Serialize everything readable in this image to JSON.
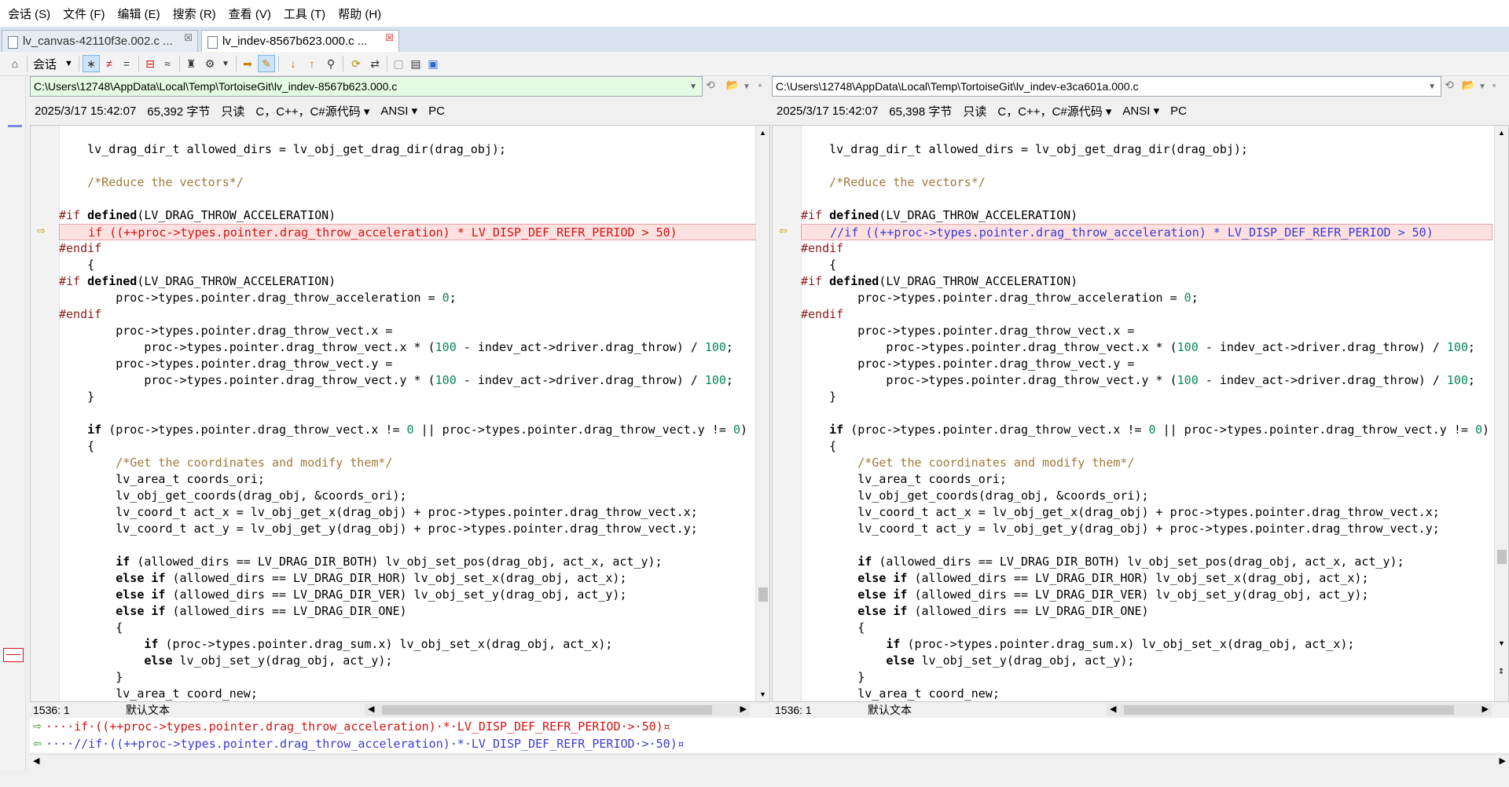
{
  "menu": [
    "会话 (S)",
    "文件 (F)",
    "编辑 (E)",
    "搜索 (R)",
    "查看 (V)",
    "工具 (T)",
    "帮助 (H)"
  ],
  "tabs": [
    {
      "label": "lv_canvas-42110f3e.002.c ...",
      "close": "☒"
    },
    {
      "label": "lv_indev-8567b623.000.c ...",
      "close": "☒"
    }
  ],
  "toolbar": {
    "session_combo": "会话"
  },
  "left": {
    "path": "C:\\Users\\12748\\AppData\\Local\\Temp\\TortoiseGit\\lv_indev-8567b623.000.c",
    "info": [
      "2025/3/17 15:42:07",
      "65,392 字节",
      "只读",
      "C，C++，C#源代码 ▾",
      "ANSI ▾",
      "PC"
    ],
    "status_pos": "1536: 1",
    "status_text": "默认文本"
  },
  "right": {
    "path": "C:\\Users\\12748\\AppData\\Local\\Temp\\TortoiseGit\\lv_indev-e3ca601a.000.c",
    "info": [
      "2025/3/17 15:42:07",
      "65,398 字节",
      "只读",
      "C，C++，C#源代码 ▾",
      "ANSI ▾",
      "PC"
    ],
    "status_pos": "1536: 1",
    "status_text": "默认文本"
  },
  "code": {
    "l1": "    lv_drag_dir_t allowed_dirs = lv_obj_get_drag_dir(drag_obj);",
    "l2": "    /*Reduce the vectors*/",
    "l3a": "#if ",
    "l3b": "defined",
    "l3c": "(LV_DRAG_THROW_ACCELERATION)",
    "left_diff": "    if ((++proc->types.pointer.drag_throw_acceleration) * LV_DISP_DEF_REFR_PERIOD > 50)",
    "right_diff": "    //if ((++proc->types.pointer.drag_throw_acceleration) * LV_DISP_DEF_REFR_PERIOD > 50)",
    "endif": "#endif",
    "brace_open": "    {",
    "l_accel_a": "        proc->types.pointer.drag_throw_acceleration = ",
    "l_accel_num": "0",
    "l_accel_b": ";",
    "vx1": "        proc->types.pointer.drag_throw_vect.x =",
    "vx2a": "            proc->types.pointer.drag_throw_vect.x * (",
    "vx2n": "100",
    "vx2b": " - indev_act->driver.drag_throw) / ",
    "vx2n2": "100",
    "vx2c": ";",
    "vy1": "        proc->types.pointer.drag_throw_vect.y =",
    "vy2a": "            proc->types.pointer.drag_throw_vect.y * (",
    "brace_close": "    }",
    "if2a": "if",
    "if2b": " (proc->types.pointer.drag_throw_vect.x != ",
    "if2n": "0",
    "if2c": " || proc->types.pointer.drag_throw_vect.y != ",
    "if2d": ")",
    "cm2": "        /*Get the coordinates and modify them*/",
    "c1": "        lv_area_t coords_ori;",
    "c2": "        lv_obj_get_coords(drag_obj, &coords_ori);",
    "c3": "        lv_coord_t act_x = lv_obj_get_x(drag_obj) + proc->types.pointer.drag_throw_vect.x;",
    "c4": "        lv_coord_t act_y = lv_obj_get_y(drag_obj) + proc->types.pointer.drag_throw_vect.y;",
    "c5": " (allowed_dirs == LV_DRAG_DIR_BOTH) lv_obj_set_pos(drag_obj, act_x, act_y);",
    "c6": " (allowed_dirs == LV_DRAG_DIR_HOR) lv_obj_set_x(drag_obj, act_x);",
    "c7": " (allowed_dirs == LV_DRAG_DIR_VER) lv_obj_set_y(drag_obj, act_y);",
    "c8": " (allowed_dirs == LV_DRAG_DIR_ONE)",
    "c9": "        {",
    "c10": " (proc->types.pointer.drag_sum.x) lv_obj_set_x(drag_obj, act_x);",
    "c11": " lv_obj_set_y(drag_obj, act_y);",
    "c12": "        }",
    "c13": "        lv_area_t coord_new;",
    "kw_if": "if",
    "kw_else": "else",
    "kw_elseif": "else if"
  },
  "diff_panel": {
    "line1": "····if·((++proc->types.pointer.drag_throw_acceleration)·*·LV_DISP_DEF_REFR_PERIOD·>·50)¤",
    "line2": "····//if·((++proc->types.pointer.drag_throw_acceleration)·*·LV_DISP_DEF_REFR_PERIOD·>·50)¤"
  }
}
